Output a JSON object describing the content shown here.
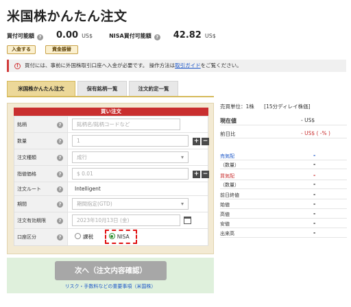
{
  "title": "米国株かんたん注文",
  "funds": {
    "buying_power_label": "買付可能額",
    "buying_power_value": "0.00",
    "buying_power_unit": "US$",
    "nisa_label": "NISA買付可能額",
    "nisa_value": "42.82",
    "nisa_unit": "US$"
  },
  "buttons": {
    "deposit": "入金する",
    "transfer": "資金振替"
  },
  "notice": {
    "text_before": "買付には、事前に外国株取引口座へ入金が必要です。 操作方法は",
    "link": "取引ガイド",
    "text_after": "をご覧ください。"
  },
  "tabs": [
    {
      "label": "米国株かんたん注文",
      "active": true
    },
    {
      "label": "保有銘柄一覧",
      "active": false
    },
    {
      "label": "注文約定一覧",
      "active": false
    }
  ],
  "form": {
    "header": "買い注文",
    "rows": {
      "symbol": {
        "label": "銘柄",
        "placeholder": "銘柄名/銘柄コードなど"
      },
      "quantity": {
        "label": "数量",
        "value": "1"
      },
      "order_type": {
        "label": "注文種類",
        "value": "成行"
      },
      "limit_price": {
        "label": "指値価格",
        "value": "$ 0.01"
      },
      "route": {
        "label": "注文ルート",
        "value": "Intelligent"
      },
      "period": {
        "label": "期間",
        "value": "期間指定(GTD)"
      },
      "expiry": {
        "label": "注文有効期限",
        "value": "2023年10月13日 (金)"
      },
      "account": {
        "label": "口座区分",
        "options": [
          "課税",
          "NISA"
        ],
        "selected": "NISA"
      }
    },
    "plus": "+",
    "minus": "−"
  },
  "submit": {
    "label": "次へ（注文内容確認）",
    "risk_link": "リスク・手数料などの重要事項（米国株）"
  },
  "info": {
    "unit_text": "売買単位：1株",
    "delay_text": "[15分ディレイ株価]",
    "current_price_label": "現在値",
    "current_price_value": "- US$",
    "change_label": "前日比",
    "change_value": "- US$ ( -% )",
    "market": [
      {
        "label": "売気配",
        "value": "-",
        "color": "#1a55c7"
      },
      {
        "label": "（数量）",
        "value": "-",
        "color": "#333333"
      },
      {
        "label": "買気配",
        "value": "-",
        "color": "#c92f2f"
      },
      {
        "label": "（数量）",
        "value": "-",
        "color": "#333333"
      },
      {
        "label": "前日終値",
        "value": "-",
        "color": "#333333"
      },
      {
        "label": "始値",
        "value": "-",
        "color": "#333333"
      },
      {
        "label": "高値",
        "value": "-",
        "color": "#333333"
      },
      {
        "label": "安値",
        "value": "-",
        "color": "#333333"
      },
      {
        "label": "出来高",
        "value": "-",
        "color": "#333333"
      }
    ]
  },
  "colors": {
    "accent_red": "#c92f2f",
    "link_blue": "#1a55c7",
    "tab_gold": "#ecd899",
    "submit_gray": "#a7a7a7",
    "highlight_dash": "#e01010"
  }
}
